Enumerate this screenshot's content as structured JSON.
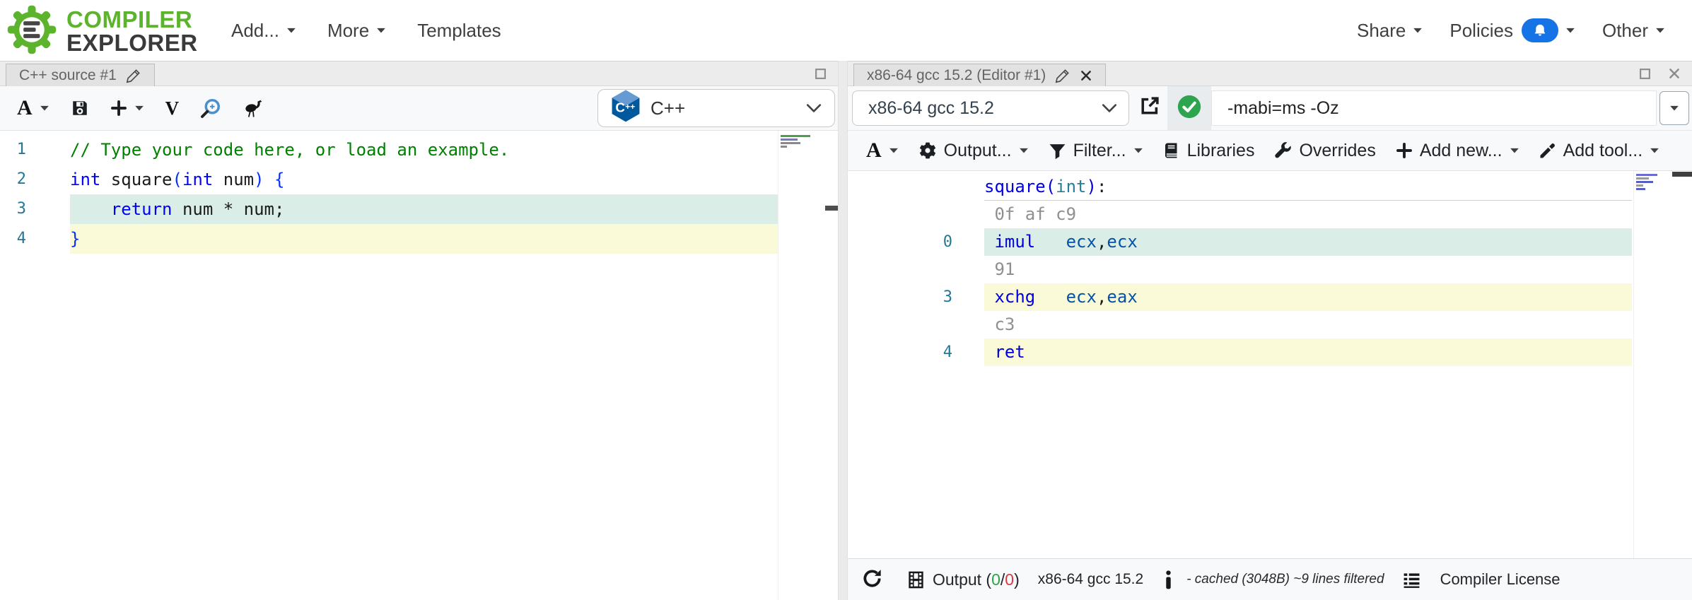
{
  "palette": {
    "brand_green": "#5cb32c",
    "keyword": "#0000ff",
    "comment": "#008000",
    "bracket": "#0431fa",
    "plain": "#1b1b1b",
    "label": "#0000e0",
    "type": "#267f99",
    "mnemonic": "#0000e0",
    "register": "#0451a5",
    "bytes": "#8f8f8f",
    "line_number": "#237893",
    "highlight_teal": "#daede6",
    "highlight_yellow": "#fafad8",
    "ok_green": "#28a745",
    "error_red": "#dc3545",
    "bell_blue": "#1673e6",
    "check_green": "#2da44e"
  },
  "navbar": {
    "logo_line1": "COMPILER",
    "logo_line2": "EXPLORER",
    "menus_left": [
      {
        "id": "add",
        "label": "Add...",
        "caret": true
      },
      {
        "id": "more",
        "label": "More",
        "caret": true
      },
      {
        "id": "templates",
        "label": "Templates",
        "caret": false
      }
    ],
    "menus_right": [
      {
        "id": "share",
        "label": "Share",
        "caret": true
      },
      {
        "id": "policies",
        "label": "Policies",
        "caret": true,
        "bell": true
      },
      {
        "id": "other",
        "label": "Other",
        "caret": true
      }
    ]
  },
  "source_pane": {
    "tab_title": "C++ source #1",
    "language_label": "C++",
    "toolbar_font_label": "A",
    "toolbar_vim_label": "V",
    "lines": [
      {
        "num": "1",
        "tokens": [
          [
            "// Type your code here, or load an example.",
            "comment"
          ]
        ]
      },
      {
        "num": "2",
        "tokens": [
          [
            "int",
            "keyword"
          ],
          [
            " square",
            "plain"
          ],
          [
            "(",
            "bracket"
          ],
          [
            "int",
            "keyword"
          ],
          [
            " num",
            "plain"
          ],
          [
            ")",
            "bracket"
          ],
          [
            " ",
            "plain"
          ],
          [
            "{",
            "bracket"
          ]
        ]
      },
      {
        "num": "3",
        "bg": "teal",
        "tokens": [
          [
            "    ",
            "plain"
          ],
          [
            "return",
            "keyword"
          ],
          [
            " num * num;",
            "plain"
          ]
        ]
      },
      {
        "num": "4",
        "bg": "yellow",
        "tokens": [
          [
            "}",
            "bracket"
          ]
        ]
      }
    ]
  },
  "asm_pane": {
    "tab_title": "x86-64 gcc 15.2 (Editor #1)",
    "compiler_label": "x86-64 gcc 15.2",
    "options_value": "-mabi=ms -Oz",
    "toolbar": [
      {
        "id": "font",
        "label": "A",
        "icon": "font-a",
        "caret": true
      },
      {
        "id": "output",
        "label": "Output...",
        "icon": "gear",
        "caret": true
      },
      {
        "id": "filter",
        "label": "Filter...",
        "icon": "funnel",
        "caret": true
      },
      {
        "id": "libraries",
        "label": "Libraries",
        "icon": "book",
        "caret": false
      },
      {
        "id": "overrides",
        "label": "Overrides",
        "icon": "wrench",
        "caret": false
      },
      {
        "id": "add-new",
        "label": "Add new...",
        "icon": "plus",
        "caret": true
      },
      {
        "id": "add-tool",
        "label": "Add tool...",
        "icon": "screwdriver",
        "caret": true
      }
    ],
    "lines": [
      {
        "num": "",
        "sep": true,
        "tokens": [
          [
            "square",
            "label"
          ],
          [
            "(",
            "label"
          ],
          [
            "int",
            "type"
          ],
          [
            ")",
            "label"
          ],
          [
            ":",
            "plain"
          ]
        ]
      },
      {
        "num": "",
        "tokens": [
          [
            " 0f af c9",
            "bytes"
          ]
        ]
      },
      {
        "num": "0",
        "bg": "teal",
        "tokens": [
          [
            " ",
            "plain"
          ],
          [
            "imul",
            "mnemonic"
          ],
          [
            "   ",
            "plain"
          ],
          [
            "ecx",
            "register"
          ],
          [
            ",",
            "plain"
          ],
          [
            "ecx",
            "register"
          ]
        ]
      },
      {
        "num": "",
        "tokens": [
          [
            " 91",
            "bytes"
          ]
        ]
      },
      {
        "num": "3",
        "bg": "yellow",
        "tokens": [
          [
            " ",
            "plain"
          ],
          [
            "xchg",
            "mnemonic"
          ],
          [
            "   ",
            "plain"
          ],
          [
            "ecx",
            "register"
          ],
          [
            ",",
            "plain"
          ],
          [
            "eax",
            "register"
          ]
        ]
      },
      {
        "num": "",
        "tokens": [
          [
            " c3",
            "bytes"
          ]
        ]
      },
      {
        "num": "4",
        "bg": "yellow",
        "tokens": [
          [
            " ",
            "plain"
          ],
          [
            "ret",
            "mnemonic"
          ]
        ]
      }
    ],
    "statusbar": {
      "output_prefix": "Output (",
      "ok_count": "0",
      "slash": "/",
      "err_count": "0",
      "close_paren": ")",
      "compiler_label": "x86-64 gcc 15.2",
      "cache_note": "- cached (3048B) ~9 lines filtered",
      "license_label": "Compiler License"
    }
  }
}
